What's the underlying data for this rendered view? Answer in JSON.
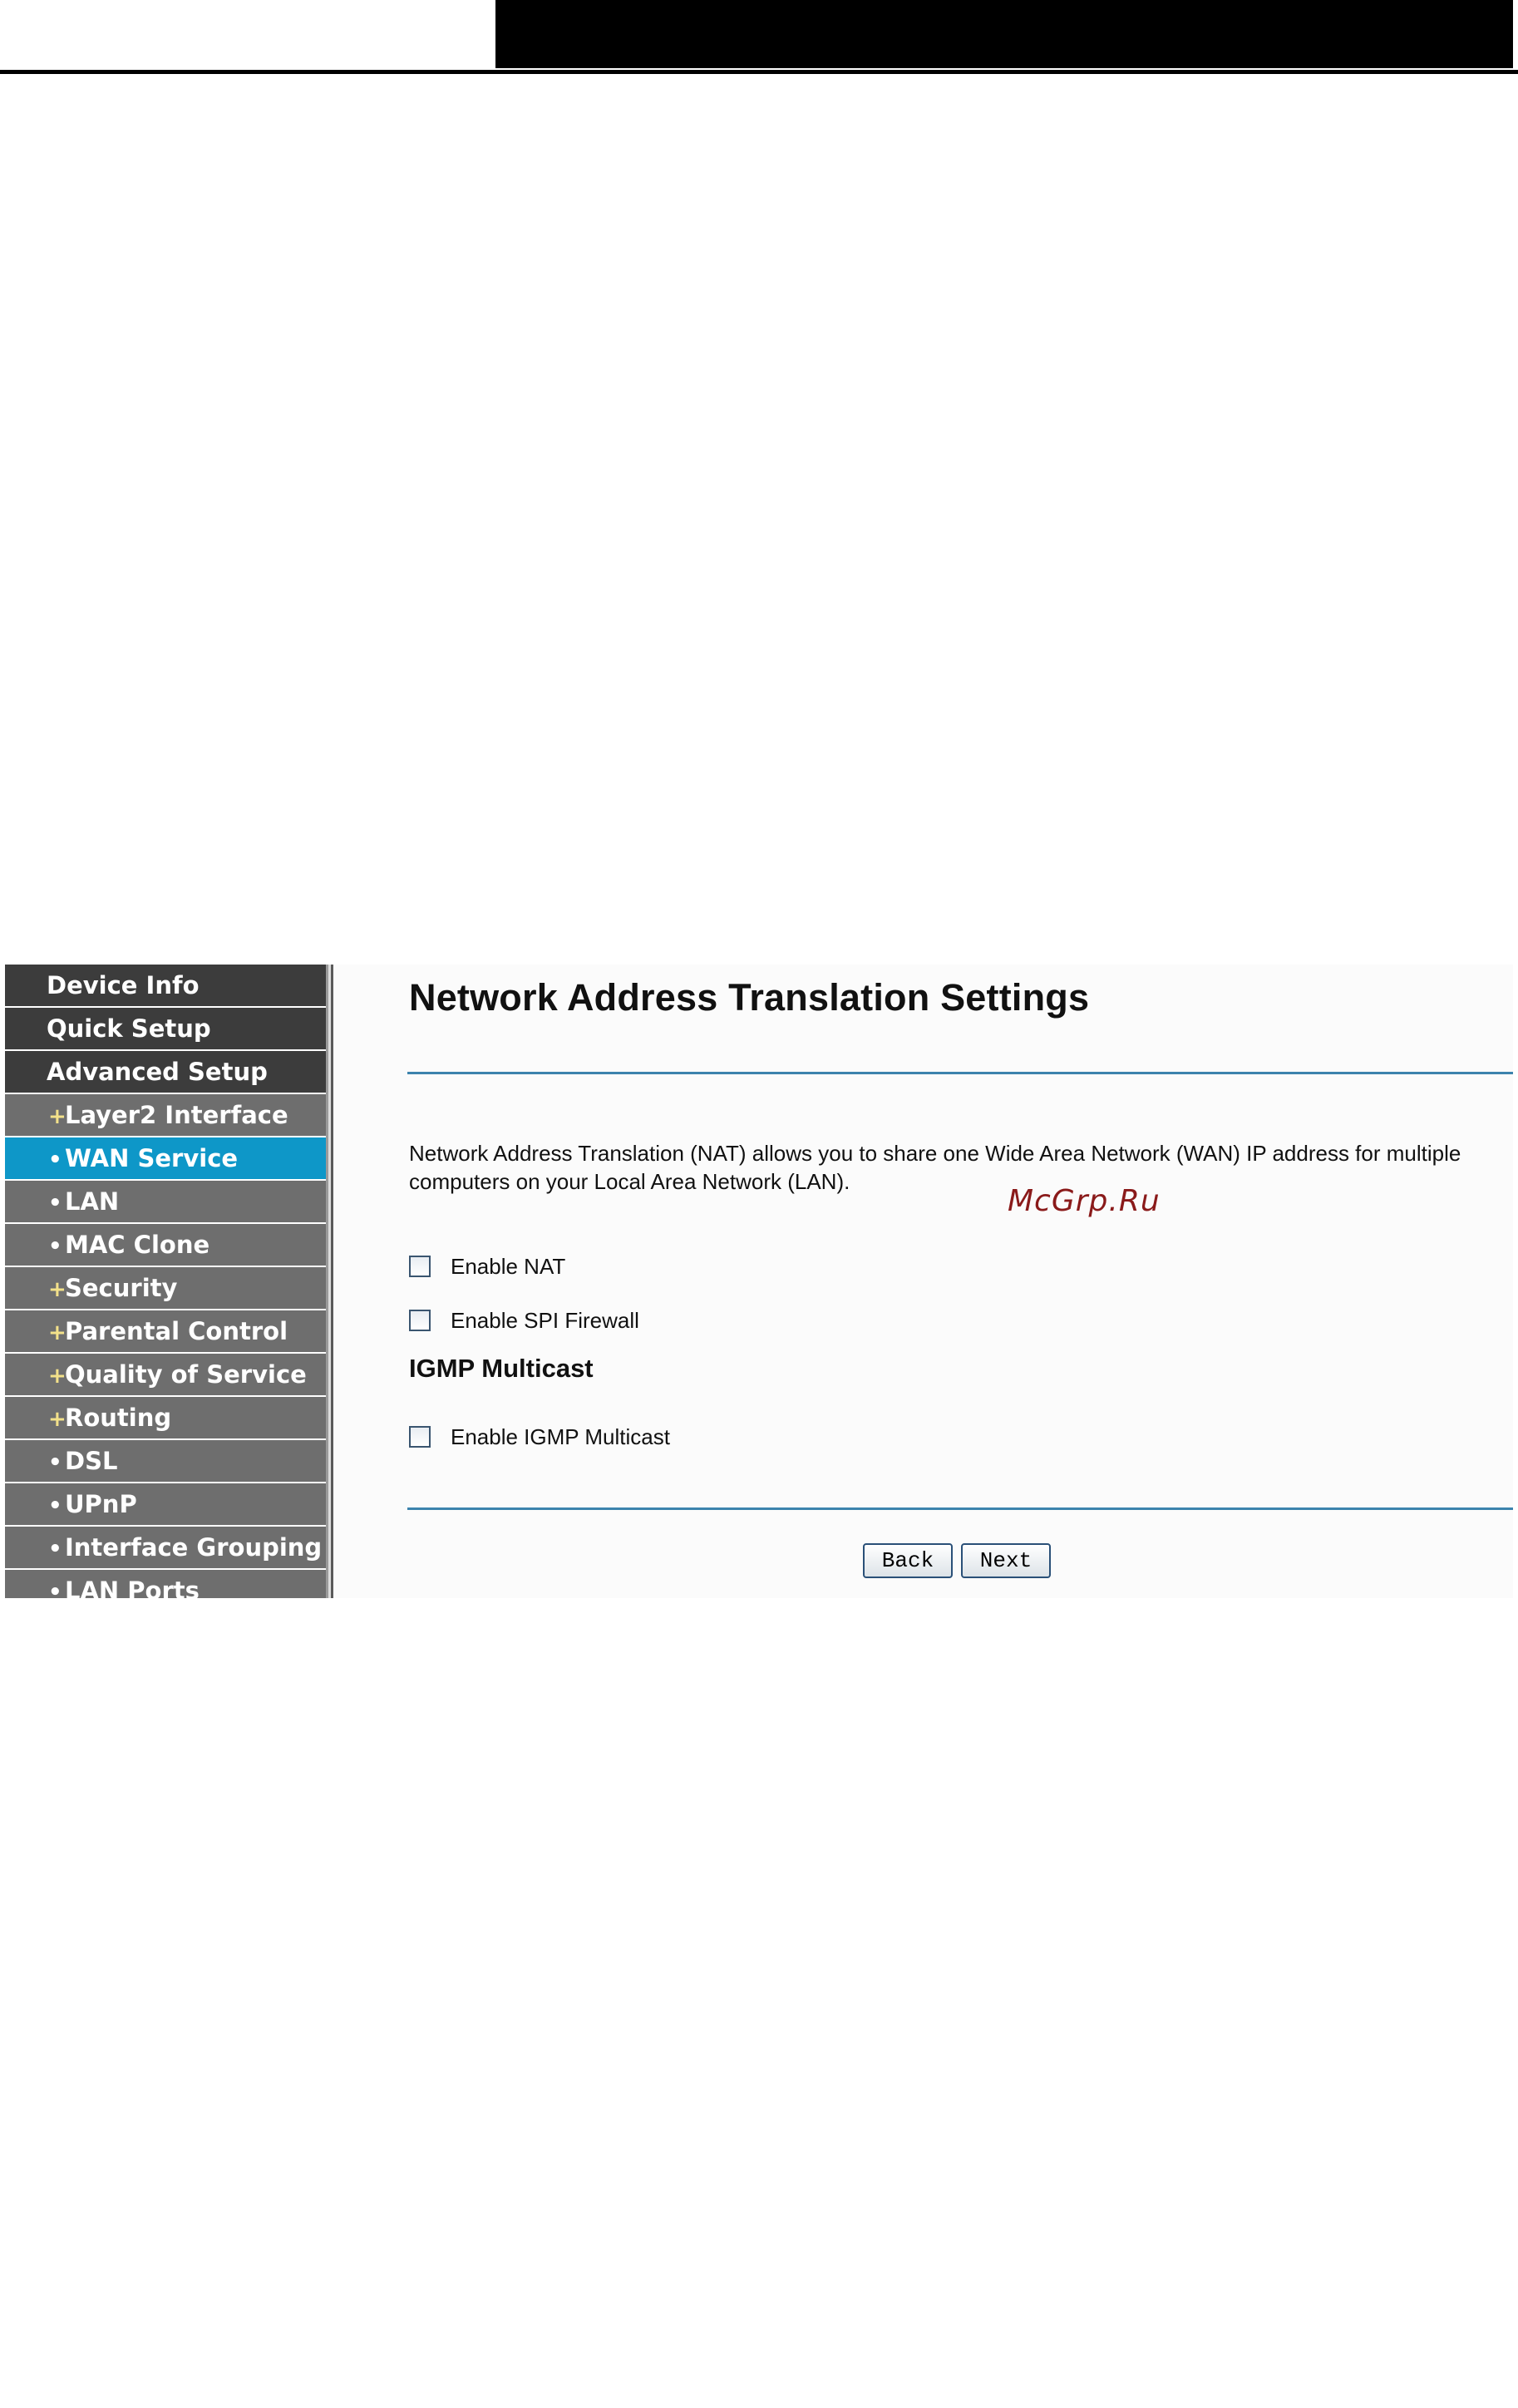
{
  "sidebar": {
    "items": [
      {
        "label": "Device Info",
        "level": "top",
        "bullet": ""
      },
      {
        "label": "Quick Setup",
        "level": "top",
        "bullet": ""
      },
      {
        "label": "Advanced Setup",
        "level": "top",
        "bullet": ""
      },
      {
        "label": "Layer2 Interface",
        "level": "sub",
        "bullet": "+"
      },
      {
        "label": "WAN Service",
        "level": "sub",
        "bullet": "•",
        "active": true
      },
      {
        "label": "LAN",
        "level": "sub",
        "bullet": "•"
      },
      {
        "label": "MAC Clone",
        "level": "sub",
        "bullet": "•"
      },
      {
        "label": "Security",
        "level": "sub",
        "bullet": "+"
      },
      {
        "label": "Parental Control",
        "level": "sub",
        "bullet": "+"
      },
      {
        "label": "Quality of Service",
        "level": "sub",
        "bullet": "+"
      },
      {
        "label": "Routing",
        "level": "sub",
        "bullet": "+"
      },
      {
        "label": "DSL",
        "level": "sub",
        "bullet": "•"
      },
      {
        "label": "UPnP",
        "level": "sub",
        "bullet": "•"
      },
      {
        "label": "Interface Grouping",
        "level": "sub",
        "bullet": "•"
      },
      {
        "label": "LAN Ports",
        "level": "sub",
        "bullet": "•"
      }
    ]
  },
  "main": {
    "title": "Network Address Translation Settings",
    "description": "Network Address Translation (NAT) allows you to share one Wide Area Network (WAN) IP address for multiple computers on your Local Area Network (LAN).",
    "watermark": "McGrp.Ru",
    "options": {
      "enable_nat": {
        "label": "Enable NAT",
        "checked": false
      },
      "enable_spi_firewall": {
        "label": "Enable SPI Firewall",
        "checked": false
      }
    },
    "igmp": {
      "section_title": "IGMP Multicast",
      "enable_igmp": {
        "label": "Enable IGMP Multicast",
        "checked": false
      }
    },
    "buttons": {
      "back": "Back",
      "next": "Next"
    }
  },
  "colors": {
    "sidebar_top": "#3c3c3c",
    "sidebar_sub": "#6e6e6e",
    "sidebar_active": "#0e97c8",
    "rule": "#3c83ad"
  }
}
